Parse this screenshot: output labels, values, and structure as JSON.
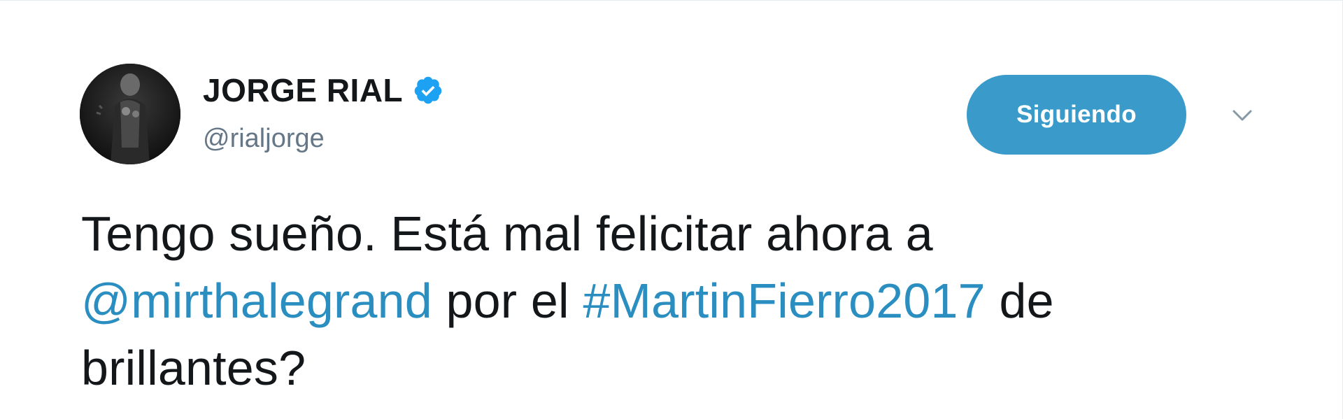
{
  "user": {
    "display_name": "JORGE RIAL",
    "handle": "@rialjorge",
    "verified": true,
    "avatar_icon": "profile-photo"
  },
  "follow_button": {
    "label": "Siguiendo",
    "color": "#3a9bcb"
  },
  "menu": {
    "icon": "chevron-down-icon"
  },
  "tweet": {
    "part1": "Tengo sueño. Está mal felicitar ahora a ",
    "mention": "@mirthalegrand",
    "part2": " por el ",
    "hashtag": "#MartinFierro2017",
    "part3": " de brillantes?"
  },
  "colors": {
    "link": "#2b8ec0",
    "text": "#14171a",
    "secondary": "#657786",
    "verified_badge": "#1da1f2"
  }
}
